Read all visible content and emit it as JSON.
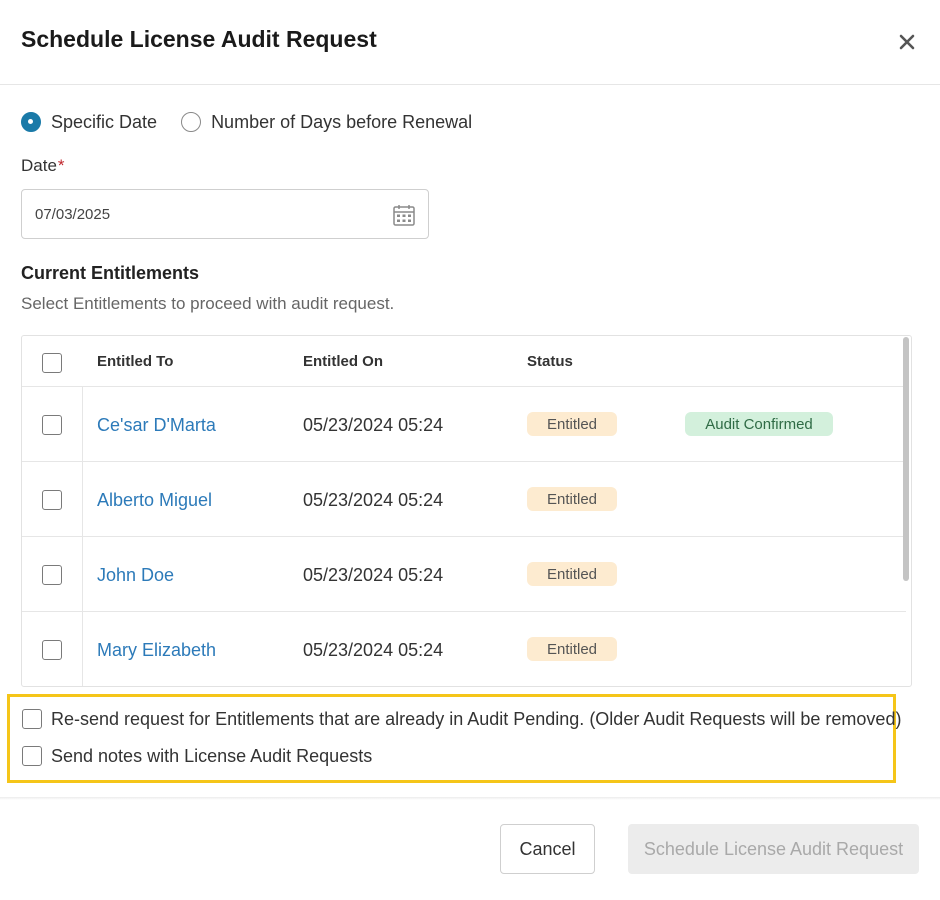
{
  "dialog": {
    "title": "Schedule License Audit Request",
    "close_icon": "close-icon"
  },
  "schedule_type": {
    "options": [
      {
        "label": "Specific Date",
        "checked": true
      },
      {
        "label": "Number of Days before Renewal",
        "checked": false
      }
    ]
  },
  "date_field": {
    "label": "Date",
    "required_marker": "*",
    "value": "07/03/2025",
    "icon": "calendar-icon"
  },
  "entitlements": {
    "title": "Current Entitlements",
    "subtitle": "Select Entitlements to proceed with audit request.",
    "columns": [
      "Entitled To",
      "Entitled On",
      "Status"
    ],
    "rows": [
      {
        "name": "Ce'sar D'Marta",
        "entitled_on": "05/23/2024 05:24",
        "status": "Entitled",
        "audit": "Audit Confirmed"
      },
      {
        "name": "Alberto Miguel",
        "entitled_on": "05/23/2024 05:24",
        "status": "Entitled",
        "audit": ""
      },
      {
        "name": "John Doe",
        "entitled_on": "05/23/2024 05:24",
        "status": "Entitled",
        "audit": ""
      },
      {
        "name": "Mary Elizabeth",
        "entitled_on": "05/23/2024 05:24",
        "status": "Entitled",
        "audit": ""
      }
    ]
  },
  "options": {
    "resend_label": "Re-send request for Entitlements that are already in Audit Pending. (Older Audit Requests will be removed)",
    "send_notes_label": "Send notes with License Audit Requests"
  },
  "footer": {
    "cancel_label": "Cancel",
    "submit_label": "Schedule License Audit Request"
  },
  "colors": {
    "accent": "#1a7aa8",
    "link": "#2c7ab9",
    "entitled_badge": "#fdebd0",
    "audit_confirmed_badge": "#d3f0dc",
    "highlight_border": "#f5c518",
    "required": "#c0272d"
  }
}
